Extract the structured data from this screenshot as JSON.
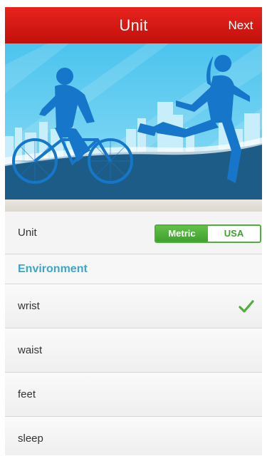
{
  "header": {
    "title": "Unit",
    "next_label": "Next"
  },
  "unit": {
    "label": "Unit",
    "options": [
      "Metric",
      "USA"
    ],
    "selected": "Metric"
  },
  "environment": {
    "title": "Environment",
    "items": [
      {
        "label": "wrist",
        "selected": true
      },
      {
        "label": "waist",
        "selected": false
      },
      {
        "label": "feet",
        "selected": false
      },
      {
        "label": "sleep",
        "selected": false
      }
    ]
  },
  "colors": {
    "header_red": "#d71a14",
    "accent_green": "#4faf3a",
    "section_blue": "#3ba6c9",
    "banner_sky": "#5fcdf0",
    "silhouette_blue": "#1676c9"
  }
}
